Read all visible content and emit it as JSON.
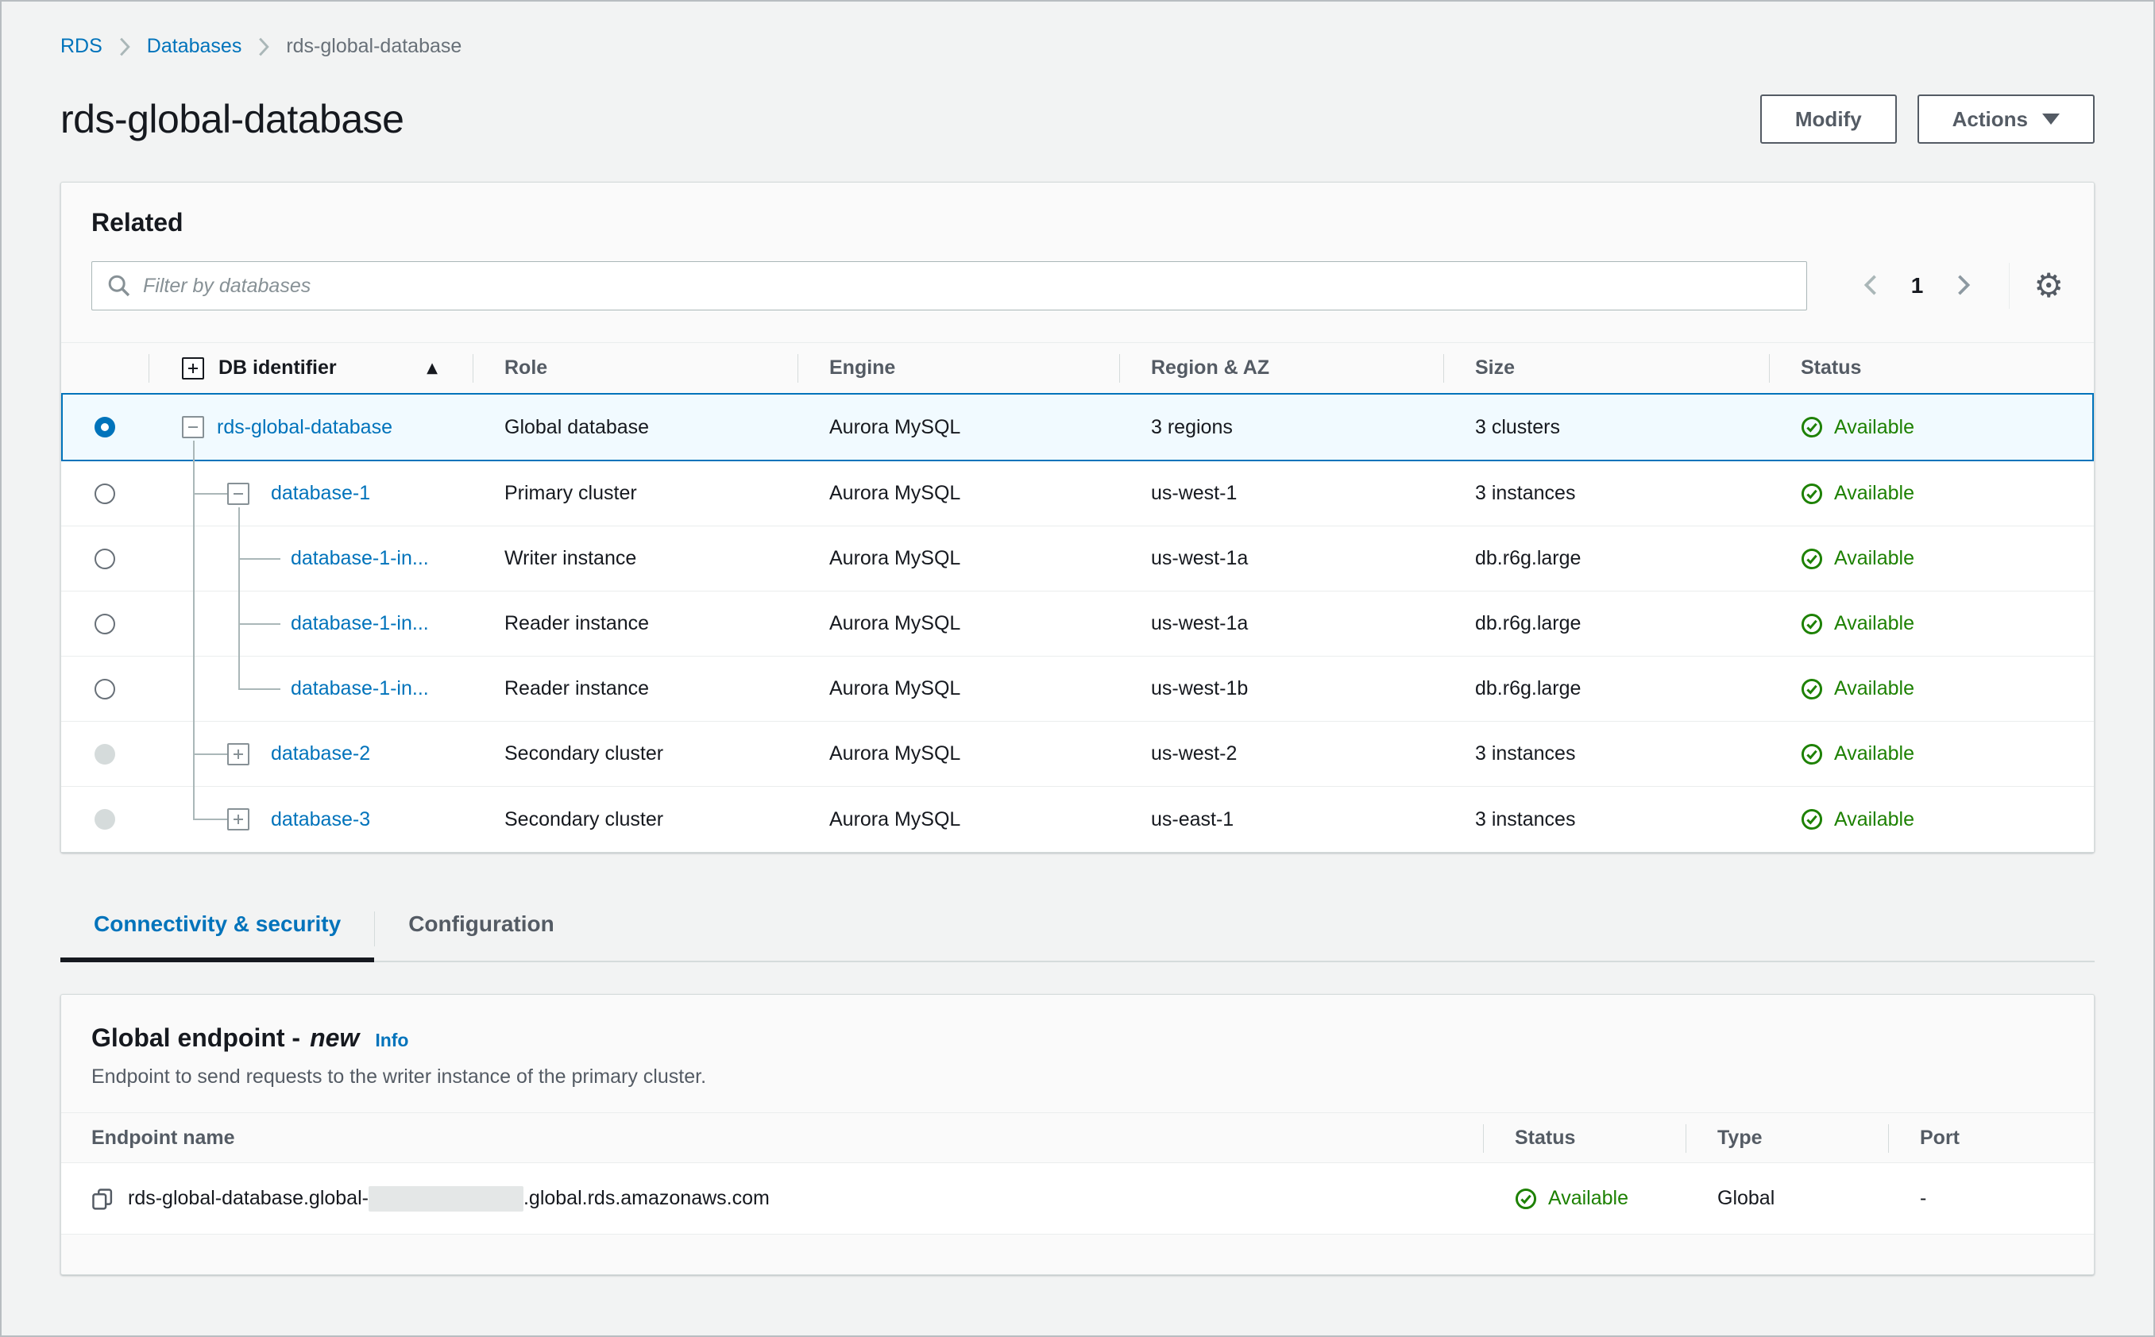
{
  "breadcrumb": {
    "items": [
      {
        "label": "RDS",
        "link": true
      },
      {
        "label": "Databases",
        "link": true
      },
      {
        "label": "rds-global-database",
        "link": false
      }
    ]
  },
  "header": {
    "title": "rds-global-database",
    "modify_label": "Modify",
    "actions_label": "Actions"
  },
  "related_panel": {
    "title": "Related",
    "filter_placeholder": "Filter by databases",
    "pagination": {
      "current_page": "1"
    },
    "table": {
      "columns": [
        "DB identifier",
        "Role",
        "Engine",
        "Region & AZ",
        "Size",
        "Status"
      ],
      "rows": [
        {
          "id": "rds-global-database",
          "role": "Global database",
          "engine": "Aurora MySQL",
          "region": "3 regions",
          "size": "3 clusters",
          "status": "Available",
          "level": 0,
          "expander": "minus",
          "radio": "selected",
          "selected": true
        },
        {
          "id": "database-1",
          "role": "Primary cluster",
          "engine": "Aurora MySQL",
          "region": "us-west-1",
          "size": "3 instances",
          "status": "Available",
          "level": 1,
          "expander": "minus",
          "radio": "normal",
          "selected": false
        },
        {
          "id": "database-1-in...",
          "role": "Writer instance",
          "engine": "Aurora MySQL",
          "region": "us-west-1a",
          "size": "db.r6g.large",
          "status": "Available",
          "level": 2,
          "expander": null,
          "radio": "normal",
          "selected": false
        },
        {
          "id": "database-1-in...",
          "role": "Reader instance",
          "engine": "Aurora MySQL",
          "region": "us-west-1a",
          "size": "db.r6g.large",
          "status": "Available",
          "level": 2,
          "expander": null,
          "radio": "normal",
          "selected": false
        },
        {
          "id": "database-1-in...",
          "role": "Reader instance",
          "engine": "Aurora MySQL",
          "region": "us-west-1b",
          "size": "db.r6g.large",
          "status": "Available",
          "level": 2,
          "expander": null,
          "radio": "normal",
          "selected": false
        },
        {
          "id": "database-2",
          "role": "Secondary cluster",
          "engine": "Aurora MySQL",
          "region": "us-west-2",
          "size": "3 instances",
          "status": "Available",
          "level": 1,
          "expander": "plus",
          "radio": "disabled",
          "selected": false
        },
        {
          "id": "database-3",
          "role": "Secondary cluster",
          "engine": "Aurora MySQL",
          "region": "us-east-1",
          "size": "3 instances",
          "status": "Available",
          "level": 1,
          "expander": "plus",
          "radio": "disabled",
          "selected": false
        }
      ]
    }
  },
  "tabs": [
    {
      "label": "Connectivity & security",
      "active": true
    },
    {
      "label": "Configuration",
      "active": false
    }
  ],
  "endpoint_panel": {
    "title_prefix": "Global endpoint -",
    "title_new": "new",
    "info_label": "Info",
    "description": "Endpoint to send requests to the writer instance of the primary cluster.",
    "table": {
      "columns": [
        "Endpoint name",
        "Status",
        "Type",
        "Port"
      ],
      "row": {
        "name_prefix": "rds-global-database.global-",
        "name_redacted": true,
        "name_suffix": ".global.rds.amazonaws.com",
        "status": "Available",
        "type": "Global",
        "port": "-"
      }
    }
  },
  "colors": {
    "link_blue": "#0073bb",
    "success_green": "#1d8102",
    "selected_row_bg": "#f1faff",
    "page_bg": "#f2f3f3",
    "text_dark": "#16191f",
    "text_gray": "#545b64"
  }
}
